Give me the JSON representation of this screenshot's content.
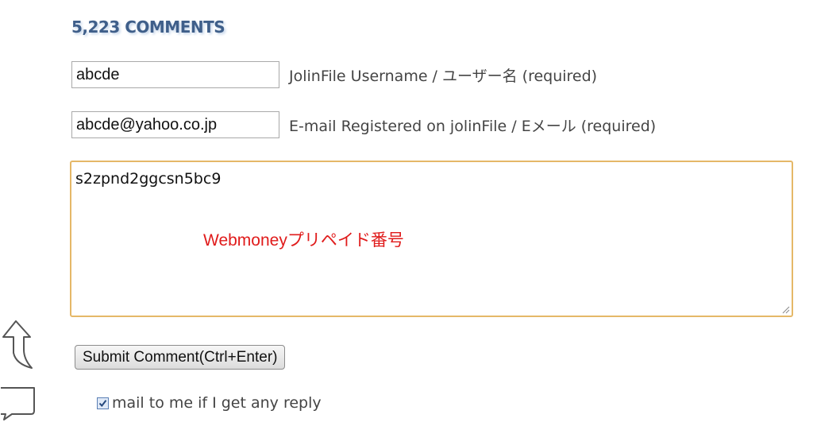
{
  "comments": {
    "count_title": "5,223 COMMENTS"
  },
  "form": {
    "username": {
      "value": "abcde",
      "label": "JolinFile Username / ユーザー名 (required)"
    },
    "email": {
      "value": "abcde@yahoo.co.jp",
      "label": "E-mail Registered on jolinFile / Eメール (required)"
    },
    "comment": {
      "value": "s2zpnd2ggcsn5bc9",
      "note": "Webmoneyプリペイド番号"
    },
    "submit_label": "Submit Comment(Ctrl+Enter)",
    "mail_reply": {
      "checked": true,
      "label": "mail to me if I get any reply"
    }
  },
  "icons": {
    "side_top": "up-arrow-icon",
    "side_bottom": "comment-bubble-icon",
    "checkbox_mark": "check-icon",
    "textarea_corner": "resize-handle-icon"
  },
  "colors": {
    "title": "#3f5f8a",
    "note": "#e01b1b",
    "textarea_focus_border": "#e5b868"
  }
}
